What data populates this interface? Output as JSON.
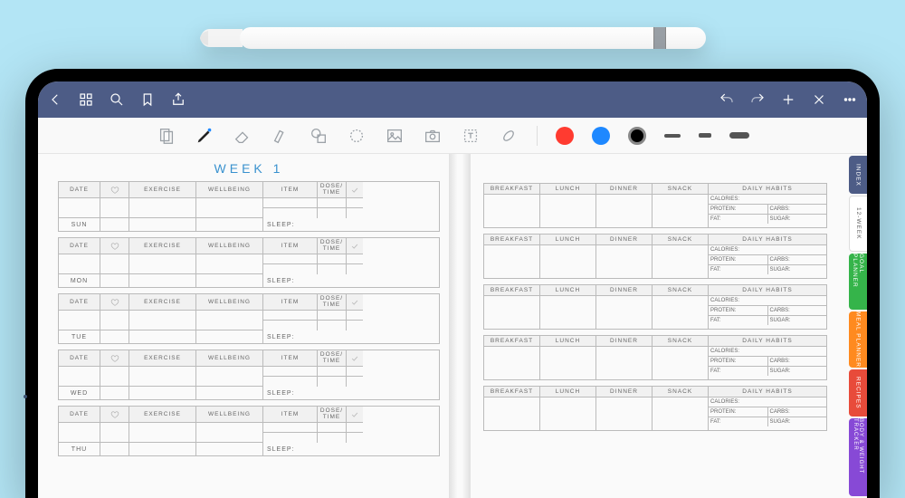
{
  "nav_icons": [
    "back",
    "grid",
    "search",
    "bookmark",
    "share"
  ],
  "nav_right_icons": [
    "undo",
    "redo",
    "add",
    "close",
    "more"
  ],
  "toolbar_icons": [
    "page-mode",
    "pen",
    "eraser",
    "highlighter",
    "shapes",
    "lasso",
    "image",
    "camera",
    "text",
    "link"
  ],
  "swatches": [
    "red",
    "blue",
    "black"
  ],
  "planner": {
    "title": "WEEK 1",
    "left_headers": {
      "date": "DATE",
      "exercise": "EXERCISE",
      "wellbeing": "WELLBEING",
      "item": "ITEM",
      "dose": "DOSE/\nTIME",
      "sleep": "SLEEP:"
    },
    "days_left": [
      "SUN",
      "MON",
      "TUE",
      "WED",
      "THU"
    ],
    "right_headers": {
      "breakfast": "BREAKFAST",
      "lunch": "LUNCH",
      "dinner": "DINNER",
      "snack": "SNACK",
      "habits": "DAILY HABITS"
    },
    "nutri": {
      "calories": "CALORIES:",
      "protein": "PROTEIN:",
      "carbs": "CARBS:",
      "fat": "FAT:",
      "sugar": "SUGAR:"
    },
    "right_rows": 5
  },
  "tabs": {
    "index": "INDEX",
    "week": "12-WEEK",
    "goal": "GOAL PLANNER",
    "meal": "MEAL PLANNER",
    "recipes": "RECIPES",
    "body": "BODY & WEIGHT TRACKER"
  }
}
